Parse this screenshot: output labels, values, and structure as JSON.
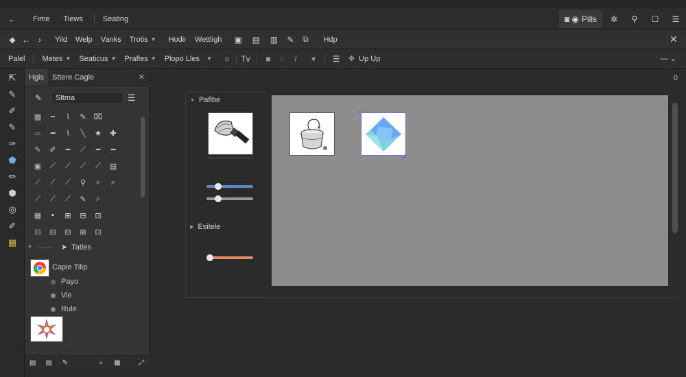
{
  "titlebar": {
    "back": "←",
    "menus": [
      "Fime",
      "Tiews",
      "Seating"
    ],
    "plan_label": "Pills",
    "win_icons": [
      "✲",
      "⚲",
      "☐",
      "☰"
    ]
  },
  "toolbar1": {
    "nav": [
      "◆",
      "←",
      "›"
    ],
    "items": [
      {
        "label": "Yild"
      },
      {
        "label": "Welp"
      },
      {
        "label": "Vanks"
      },
      {
        "label": "Trotis",
        "caret": true
      },
      {
        "label": "Hodir"
      },
      {
        "label": "Wettligh"
      }
    ],
    "icon_group": [
      "▣",
      "▤",
      "▥",
      "✎",
      "⧉"
    ],
    "extra": "Hdp",
    "close": "✕"
  },
  "toolbar2": {
    "items": [
      {
        "label": "Palel"
      },
      {
        "label": "Metes",
        "caret": true
      },
      {
        "label": "Seaticus",
        "caret": true
      },
      {
        "label": "Prafles",
        "caret": true
      },
      {
        "label": "Plopo Lles",
        "caret": true
      }
    ],
    "icons": [
      "○",
      "Tv",
      "■",
      "◌",
      "/",
      "▾",
      "☰"
    ],
    "up_label": "Up Up",
    "right_caret": "—  ⌄"
  },
  "tools": [
    "⇱",
    "✎",
    "✐",
    "✎",
    "✑",
    "⬟",
    "✏",
    "⬢",
    "◎",
    "✐",
    "▦"
  ],
  "panel": {
    "tabs": [
      "Hgis",
      "Sttere Cagle"
    ],
    "search_value": "Sltma",
    "search_icon": "✎",
    "glyphs": [
      "▩",
      "╍",
      "⌇",
      "✎",
      "⌧",
      "",
      "⌓",
      "━",
      "⌇",
      "╲",
      "★",
      "✚",
      "✎",
      "✐",
      "━",
      "⟋",
      "━",
      "━",
      "▣",
      "⟋",
      "⟋",
      "⟋",
      "⟋",
      "▤",
      "⟋",
      "⟋",
      "⟋",
      "⚲",
      "⌕",
      "⌕",
      "⟋",
      "⟋",
      "⟋",
      "✎",
      "⌕",
      "",
      "▦",
      "▪",
      "⊞",
      "⊟",
      "⊡",
      "",
      "⊟",
      "⊟",
      "⊟",
      "⊞",
      "⊡",
      ""
    ],
    "section_title": "Tatles",
    "item_title": "Capie Tilip",
    "sub_items": [
      "Payo",
      "Vie",
      "Rule"
    ],
    "footer_icons": [
      "▤",
      "▤",
      "✎",
      "",
      "⌕",
      "▦",
      "⤢"
    ]
  },
  "workspace": {
    "ruler_value": "0",
    "group1_label": "Paflbe",
    "group2_label": "Esitele"
  },
  "colors": {
    "canvas": "#8d8d8d",
    "slider_blue": "#5a86c8",
    "slider_gray": "#9a9a9a",
    "slider_orange": "#e08a64",
    "accent_chrome": "#4285f4"
  },
  "sliders": [
    {
      "name": "blue",
      "value": 0.25
    },
    {
      "name": "gray",
      "value": 0.25
    },
    {
      "name": "orange",
      "value": 0.08
    }
  ]
}
